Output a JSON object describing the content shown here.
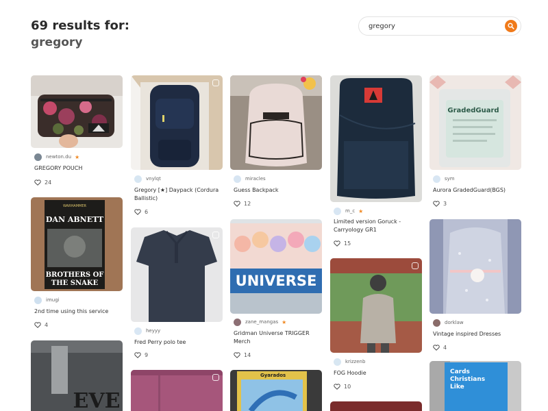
{
  "header": {
    "results_label": "69 results for:",
    "query": "gregory"
  },
  "search": {
    "value": "gregory",
    "icon": "search-icon",
    "button_color": "#f07a1a"
  },
  "colors": {
    "accent": "#f07a1a",
    "medal": "#f08a24"
  },
  "listings": [
    {
      "seller": "newton.du",
      "medal": true,
      "title": "GREGORY POUCH",
      "likes": "24"
    },
    {
      "seller": "vnylqt",
      "medal": false,
      "title": "Gregory [★] Daypack (Cordura Ballistic)",
      "likes": "6"
    },
    {
      "seller": "miracles",
      "medal": false,
      "title": "Guess Backpack",
      "likes": "12"
    },
    {
      "seller": "m_c",
      "medal": true,
      "title": "Limited version Goruck - Carryology GR1",
      "likes": "15"
    },
    {
      "seller": "sym",
      "medal": false,
      "title": "Aurora GradedGuard(BGS)",
      "likes": "3",
      "image_text": "GradedGuard"
    },
    {
      "seller": "imugi",
      "medal": false,
      "title": "2nd time using this service",
      "likes": "4",
      "image_text": [
        "WARHAMMER",
        "DAN ABNETT",
        "BROTHERS OF",
        "THE SNAKE"
      ]
    },
    {
      "seller": "heyyy",
      "medal": false,
      "title": "Fred Perry polo tee",
      "likes": "9"
    },
    {
      "seller": "zane_mangas",
      "medal": true,
      "title": "Gridman Universe TRIGGER Merch",
      "likes": "14",
      "image_text": "UNIVERSE"
    },
    {
      "seller": "krizzenb",
      "medal": false,
      "title": "FOG Hoodie",
      "likes": "10"
    },
    {
      "seller": "dorklaw",
      "medal": false,
      "title": "Vintage inspired Dresses",
      "likes": "4"
    },
    {
      "image_text": "EVE"
    },
    {},
    {
      "image_text": "Gyarados"
    },
    {},
    {
      "image_text": [
        "Cards",
        "Christians",
        "Like"
      ]
    }
  ]
}
